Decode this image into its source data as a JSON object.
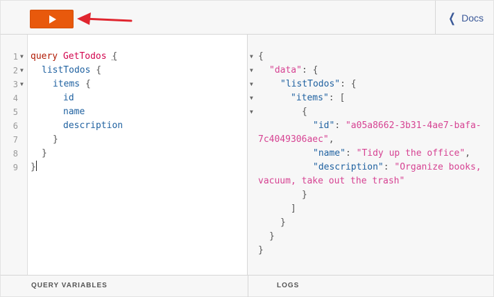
{
  "toolbar": {
    "run_icon": "play-icon",
    "docs_label": "Docs",
    "docs_icon": "chevron-left-icon",
    "arrow_color": "#e0262f",
    "run_color": "#e8590c"
  },
  "query_editor": {
    "lines": [
      {
        "num": "1",
        "fold": true
      },
      {
        "num": "2",
        "fold": true
      },
      {
        "num": "3",
        "fold": true
      },
      {
        "num": "4",
        "fold": false
      },
      {
        "num": "5",
        "fold": false
      },
      {
        "num": "6",
        "fold": false
      },
      {
        "num": "7",
        "fold": false
      },
      {
        "num": "8",
        "fold": false
      },
      {
        "num": "9",
        "fold": false
      }
    ],
    "tokens": {
      "kw_query": "query",
      "op_name": "GetTodos",
      "brace_open": "{",
      "brace_close": "}",
      "f_listTodos": "listTodos",
      "f_items": "items",
      "f_id": "id",
      "f_name": "name",
      "f_description": "description"
    }
  },
  "result_viewer": {
    "tokens": {
      "k_data": "\"data\"",
      "k_listTodos": "\"listTodos\"",
      "k_items": "\"items\"",
      "k_id": "\"id\"",
      "v_id_1": "\"a05a8662-3b31-4ae7-bafa-",
      "v_id_2": "7c4049306aec\"",
      "k_name": "\"name\"",
      "v_name": "\"Tidy up the office\"",
      "k_description": "\"description\"",
      "v_desc_1": "\"Organize books,",
      "v_desc_2": "vacuum, take out the trash\""
    }
  },
  "footer": {
    "query_variables_label": "QUERY VARIABLES",
    "logs_label": "LOGS"
  }
}
